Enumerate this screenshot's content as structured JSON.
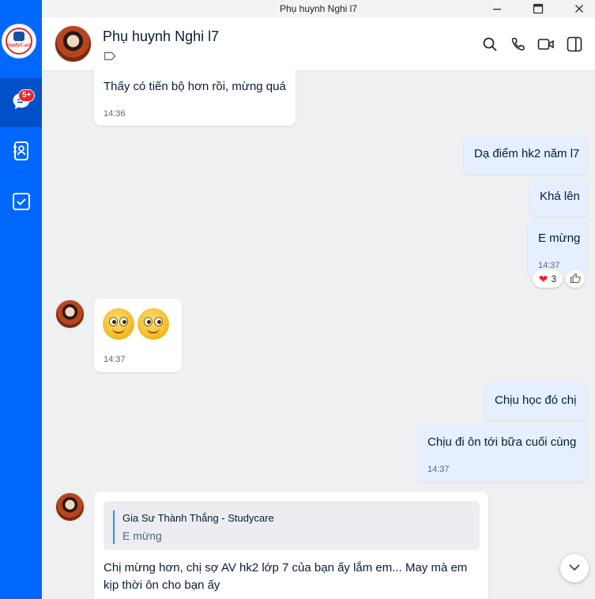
{
  "window": {
    "title": "Phụ huynh Nghi l7"
  },
  "sidebar": {
    "logo_text": "StudyCare",
    "chat_badge": "5+",
    "items": [
      {
        "name": "chat",
        "icon": "chat-bubble-icon"
      },
      {
        "name": "contacts",
        "icon": "contact-book-icon"
      },
      {
        "name": "todo",
        "icon": "checkbox-icon"
      }
    ]
  },
  "header": {
    "name": "Phụ huynh Nghi l7",
    "icons": [
      "search-icon",
      "phone-icon",
      "video-call-icon",
      "sidebar-toggle-icon"
    ]
  },
  "messages": [
    {
      "side": "received",
      "text": "Thấy có tiến bộ hơn rồi, mừng quá",
      "time": "14:36"
    },
    {
      "side": "sent",
      "text": "Dạ điểm hk2 năm l7"
    },
    {
      "side": "sent",
      "text": "Khá lên"
    },
    {
      "side": "sent",
      "text": "E mừng",
      "time": "14:37",
      "reaction": {
        "emoji": "❤",
        "count": "3"
      }
    },
    {
      "side": "received",
      "type": "emoji",
      "time": "14:37"
    },
    {
      "side": "sent",
      "text": "Chịu học đó chị"
    },
    {
      "side": "sent",
      "text": "Chịu đi ôn tới bữa cuối cùng",
      "time": "14:37"
    },
    {
      "side": "received",
      "quote": {
        "author": "Gia Sư Thành Thắng - Studycare",
        "text": "E mừng"
      },
      "text": "Chị mừng hơn, chị sợ AV hk2 lớp 7 của bạn ấy lắm em... May mà em kịp thời ôn cho bạn ấy"
    }
  ],
  "colors": {
    "accent": "#0068ff",
    "sent_bubble": "#e5efff",
    "badge": "#e5262a"
  }
}
